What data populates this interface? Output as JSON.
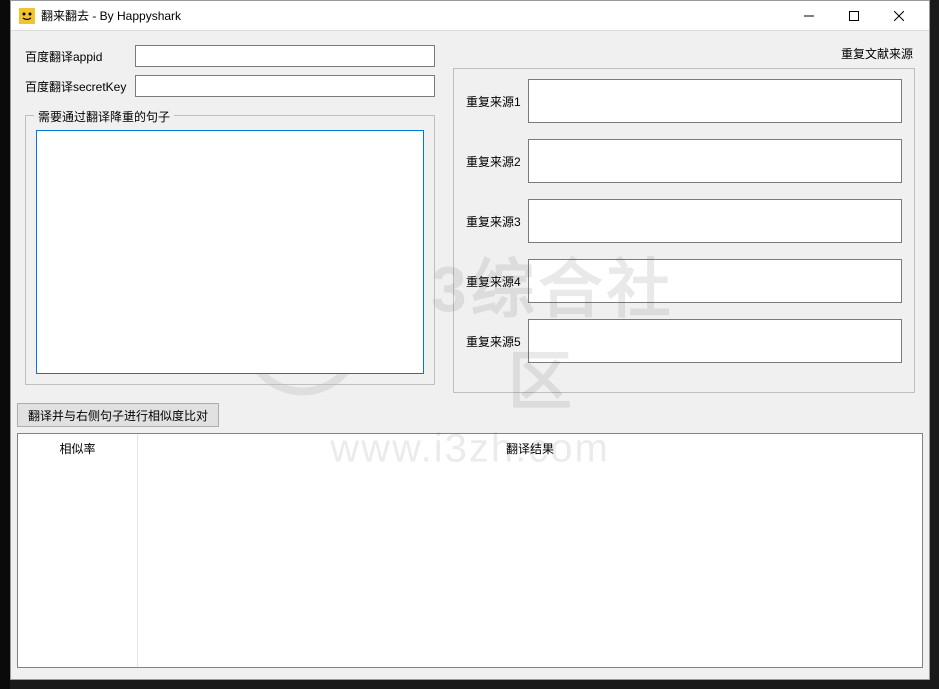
{
  "window": {
    "title": "翻来翻去 - By Happyshark",
    "icon_name": "app-icon"
  },
  "left_panel": {
    "appid_label": "百度翻译appid",
    "appid_value": "",
    "secretkey_label": "百度翻译secretKey",
    "secretkey_value": "",
    "groupbox_title": "需要通过翻译降重的句子",
    "sentence_value": ""
  },
  "right_panel": {
    "title": "重复文献来源",
    "sources": [
      {
        "label": "重复来源1",
        "value": ""
      },
      {
        "label": "重复来源2",
        "value": ""
      },
      {
        "label": "重复来源3",
        "value": ""
      },
      {
        "label": "重复来源4",
        "value": ""
      },
      {
        "label": "重复来源5",
        "value": ""
      }
    ]
  },
  "action_button": "翻译并与右侧句子进行相似度比对",
  "results": {
    "similarity_header": "相似率",
    "translation_header": "翻译结果"
  },
  "watermark": {
    "text": "i3综合社区",
    "url": "www.i3zh.com"
  }
}
